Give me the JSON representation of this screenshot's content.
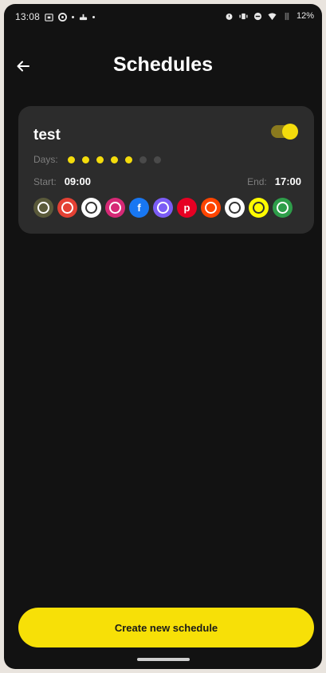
{
  "status_bar": {
    "time": "13:08",
    "battery": "12%",
    "left_icons": [
      "calendar-icon",
      "pulse-icon",
      "dot",
      "cake-icon",
      "dot"
    ],
    "right_icons": [
      "alarm-icon",
      "vibrate-icon",
      "dnd-icon",
      "wifi-icon",
      "signal-icon"
    ]
  },
  "header": {
    "title": "Schedules",
    "back_icon": "back-arrow-icon"
  },
  "schedule": {
    "name": "test",
    "enabled": true,
    "days_label": "Days:",
    "days_active": [
      true,
      true,
      true,
      true,
      true,
      false,
      false
    ],
    "start_label": "Start:",
    "start_value": "09:00",
    "end_label": "End:",
    "end_value": "17:00",
    "apps": [
      {
        "name": "custom-app",
        "icon": "plant-icon",
        "color": "#5a5a3a",
        "glyph": ""
      },
      {
        "name": "chrome",
        "icon": "chrome-icon",
        "color": "#e44134",
        "glyph": ""
      },
      {
        "name": "google-drive",
        "icon": "drive-icon",
        "color": "#ffffff",
        "glyph": ""
      },
      {
        "name": "instagram",
        "icon": "instagram-icon",
        "color": "#d62976",
        "glyph": ""
      },
      {
        "name": "facebook",
        "icon": "facebook-icon",
        "color": "#1877f2",
        "glyph": "f"
      },
      {
        "name": "messenger",
        "icon": "messenger-icon",
        "color": "#7b5cf5",
        "glyph": ""
      },
      {
        "name": "pinterest",
        "icon": "pinterest-icon",
        "color": "#e60023",
        "glyph": "p"
      },
      {
        "name": "reddit",
        "icon": "reddit-icon",
        "color": "#ff4500",
        "glyph": ""
      },
      {
        "name": "slack",
        "icon": "slack-icon",
        "color": "#ffffff",
        "glyph": ""
      },
      {
        "name": "snapchat",
        "icon": "snapchat-icon",
        "color": "#fffc00",
        "glyph": ""
      },
      {
        "name": "green-app",
        "icon": "green-app-icon",
        "color": "#2e9e4a",
        "glyph": ""
      }
    ]
  },
  "footer": {
    "create_label": "Create new schedule"
  },
  "colors": {
    "accent": "#f7e007",
    "background": "#121212",
    "card": "#2c2c2c"
  }
}
